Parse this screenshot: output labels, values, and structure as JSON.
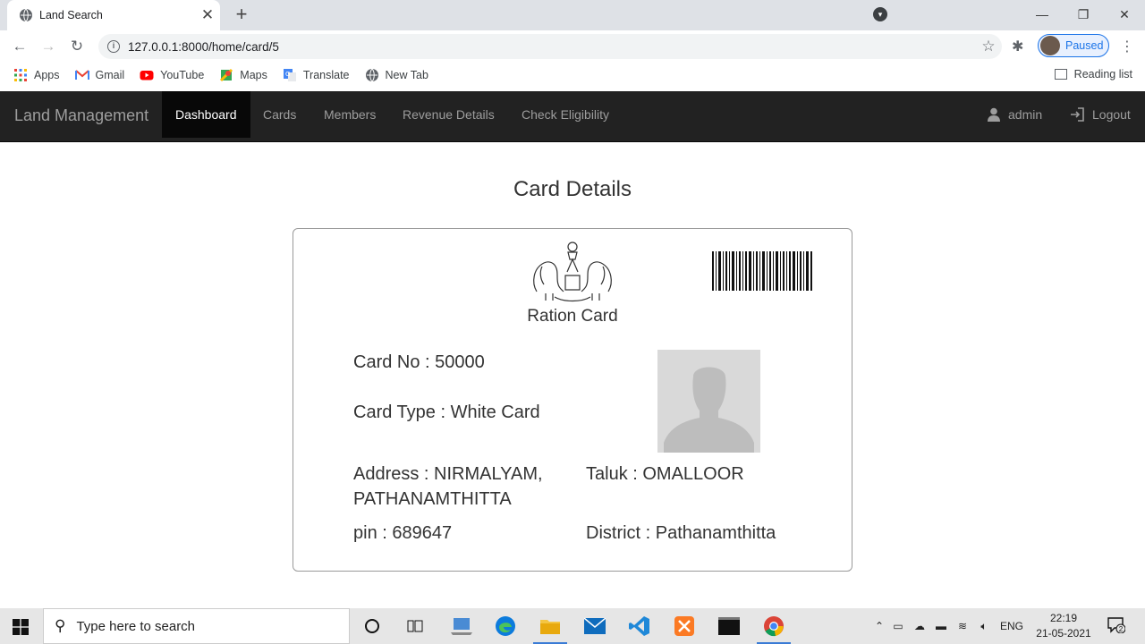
{
  "browser": {
    "tab_title": "Land Search",
    "url": "127.0.0.1:8000/home/card/5",
    "profile_label": "Paused",
    "bookmarks": [
      {
        "label": "Apps",
        "icon": "apps-grid-icon"
      },
      {
        "label": "Gmail",
        "icon": "gmail-icon"
      },
      {
        "label": "YouTube",
        "icon": "youtube-icon"
      },
      {
        "label": "Maps",
        "icon": "maps-icon"
      },
      {
        "label": "Translate",
        "icon": "translate-icon"
      },
      {
        "label": "New Tab",
        "icon": "globe-icon"
      }
    ],
    "reading_list": "Reading list"
  },
  "navbar": {
    "brand": "Land Management",
    "links": [
      {
        "label": "Dashboard",
        "active": true
      },
      {
        "label": "Cards",
        "active": false
      },
      {
        "label": "Members",
        "active": false
      },
      {
        "label": "Revenue Details",
        "active": false
      },
      {
        "label": "Check Eligibility",
        "active": false
      }
    ],
    "user": "admin",
    "logout": "Logout"
  },
  "page": {
    "title": "Card Details",
    "card": {
      "label": "Ration Card",
      "card_no": "Card No : 50000",
      "card_type": "Card Type : White Card",
      "address_line1": "Address : NIRMALYAM,",
      "address_line2": "PATHANAMTHITTA",
      "pin": "pin : 689647",
      "taluk": "Taluk : OMALLOOR",
      "district": "District : Pathanamthitta"
    }
  },
  "taskbar": {
    "search_placeholder": "Type here to search",
    "language": "ENG",
    "time": "22:19",
    "date": "21-05-2021",
    "notification_count": "2"
  }
}
